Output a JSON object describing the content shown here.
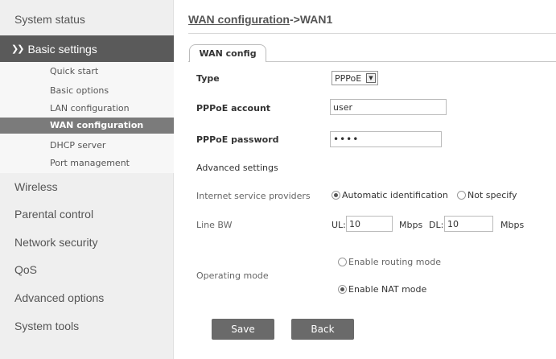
{
  "sidebar": {
    "system_status": "System status",
    "basic_settings": "Basic settings",
    "basic_icon": "double-chevron-down",
    "submenu": [
      "Quick start",
      "Basic options",
      "LAN configuration",
      "WAN configuration",
      "DHCP server",
      "Port management"
    ],
    "active_submenu": "WAN configuration",
    "others": [
      "Wireless",
      "Parental control",
      "Network security",
      "QoS",
      "Advanced options",
      "System tools"
    ]
  },
  "breadcrumb": {
    "link": "WAN configuration",
    "separator": "->",
    "current": "WAN1"
  },
  "tab": {
    "label": "WAN config"
  },
  "form": {
    "type_label": "Type",
    "type_value": "PPPoE",
    "account_label": "PPPoE account",
    "account_value": "user",
    "password_label": "PPPoE password",
    "password_value": "••••",
    "advanced_label": "Advanced settings",
    "isp_label": "Internet service providers",
    "isp_options": [
      "Automatic identification",
      "Not specify"
    ],
    "isp_selected": "Automatic identification",
    "linebw_label": "Line BW",
    "ul_label": "UL:",
    "ul_value": "10",
    "ul_unit": "Mbps",
    "dl_label": "DL:",
    "dl_value": "10",
    "dl_unit": "Mbps",
    "mode_label": "Operating mode",
    "mode_options": [
      "Enable routing mode",
      "Enable NAT mode"
    ],
    "mode_selected": "Enable NAT mode"
  },
  "buttons": {
    "save": "Save",
    "back": "Back"
  },
  "colors": {
    "sidebar_bg": "#efefef",
    "active_bg": "#5a5a5a",
    "button_bg": "#6a6a6a"
  }
}
